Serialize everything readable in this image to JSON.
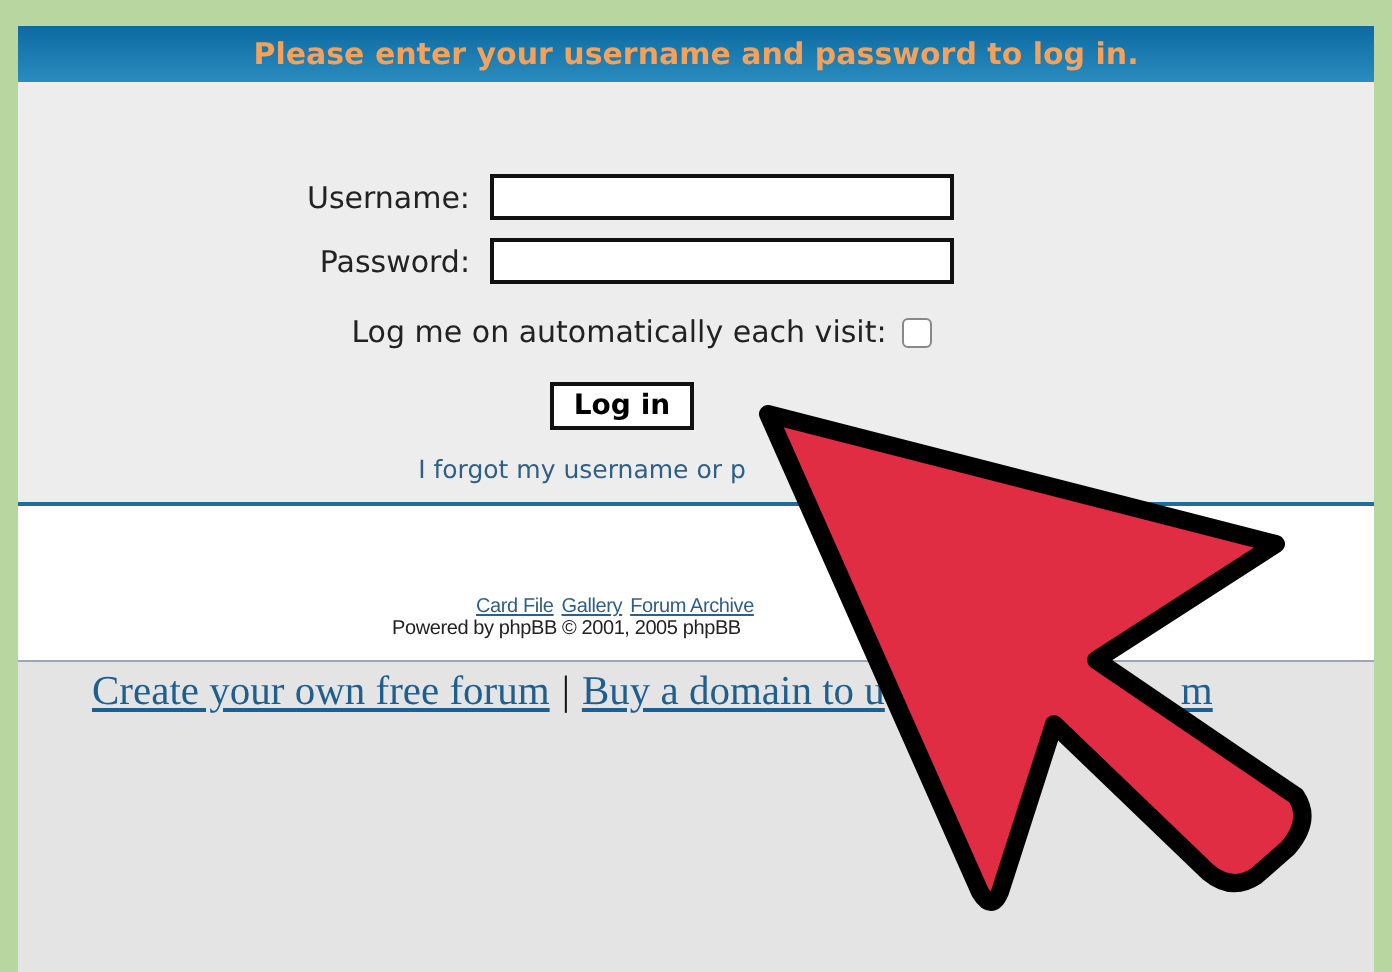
{
  "header": {
    "title": "Please enter your username and password to log in."
  },
  "form": {
    "fields": [
      {
        "label": "Username:"
      },
      {
        "label": "Password:"
      }
    ],
    "autologin": {
      "label": "Log me on automatically each visit:",
      "checked": false
    },
    "submit": "Log in",
    "forgot_link": "I forgot my username or p"
  },
  "footer": {
    "links": [
      "Card File",
      "Gallery",
      "Forum Archive"
    ],
    "powered": "Powered by phpBB © 2001, 2005 phpBB"
  },
  "bottom_links": {
    "items": [
      "Create your own free forum",
      "Buy a domain to u"
    ],
    "separator": "|",
    "tail": "m"
  }
}
